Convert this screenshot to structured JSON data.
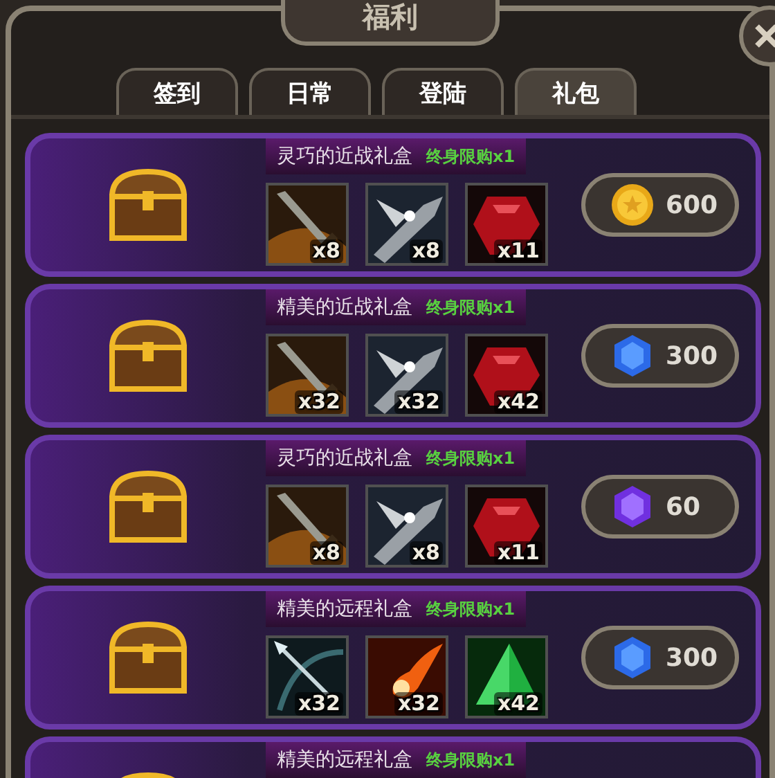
{
  "window": {
    "title": "福利"
  },
  "tabs": [
    {
      "label": "签到",
      "selected": false
    },
    {
      "label": "日常",
      "selected": false
    },
    {
      "label": "登陆",
      "selected": false
    },
    {
      "label": "礼包",
      "selected": true
    }
  ],
  "packs": [
    {
      "name": "灵巧的近战礼盒",
      "limit": "终身限购x1",
      "items": [
        {
          "kind": "sword",
          "count": "x8"
        },
        {
          "kind": "blade",
          "count": "x8"
        },
        {
          "kind": "ruby",
          "count": "x11"
        }
      ],
      "price": {
        "kind": "coin",
        "amount": "600"
      }
    },
    {
      "name": "精美的近战礼盒",
      "limit": "终身限购x1",
      "items": [
        {
          "kind": "sword",
          "count": "x32"
        },
        {
          "kind": "blade",
          "count": "x32"
        },
        {
          "kind": "ruby",
          "count": "x42"
        }
      ],
      "price": {
        "kind": "blue-gem",
        "amount": "300"
      }
    },
    {
      "name": "灵巧的近战礼盒",
      "limit": "终身限购x1",
      "items": [
        {
          "kind": "sword",
          "count": "x8"
        },
        {
          "kind": "blade",
          "count": "x8"
        },
        {
          "kind": "ruby",
          "count": "x11"
        }
      ],
      "price": {
        "kind": "purple-gem",
        "amount": "60"
      }
    },
    {
      "name": "精美的远程礼盒",
      "limit": "终身限购x1",
      "items": [
        {
          "kind": "arrow",
          "count": "x32"
        },
        {
          "kind": "fireball",
          "count": "x32"
        },
        {
          "kind": "emerald",
          "count": "x42"
        }
      ],
      "price": {
        "kind": "blue-gem",
        "amount": "300"
      }
    },
    {
      "name": "精美的远程礼盒",
      "limit": "终身限购x1"
    }
  ]
}
